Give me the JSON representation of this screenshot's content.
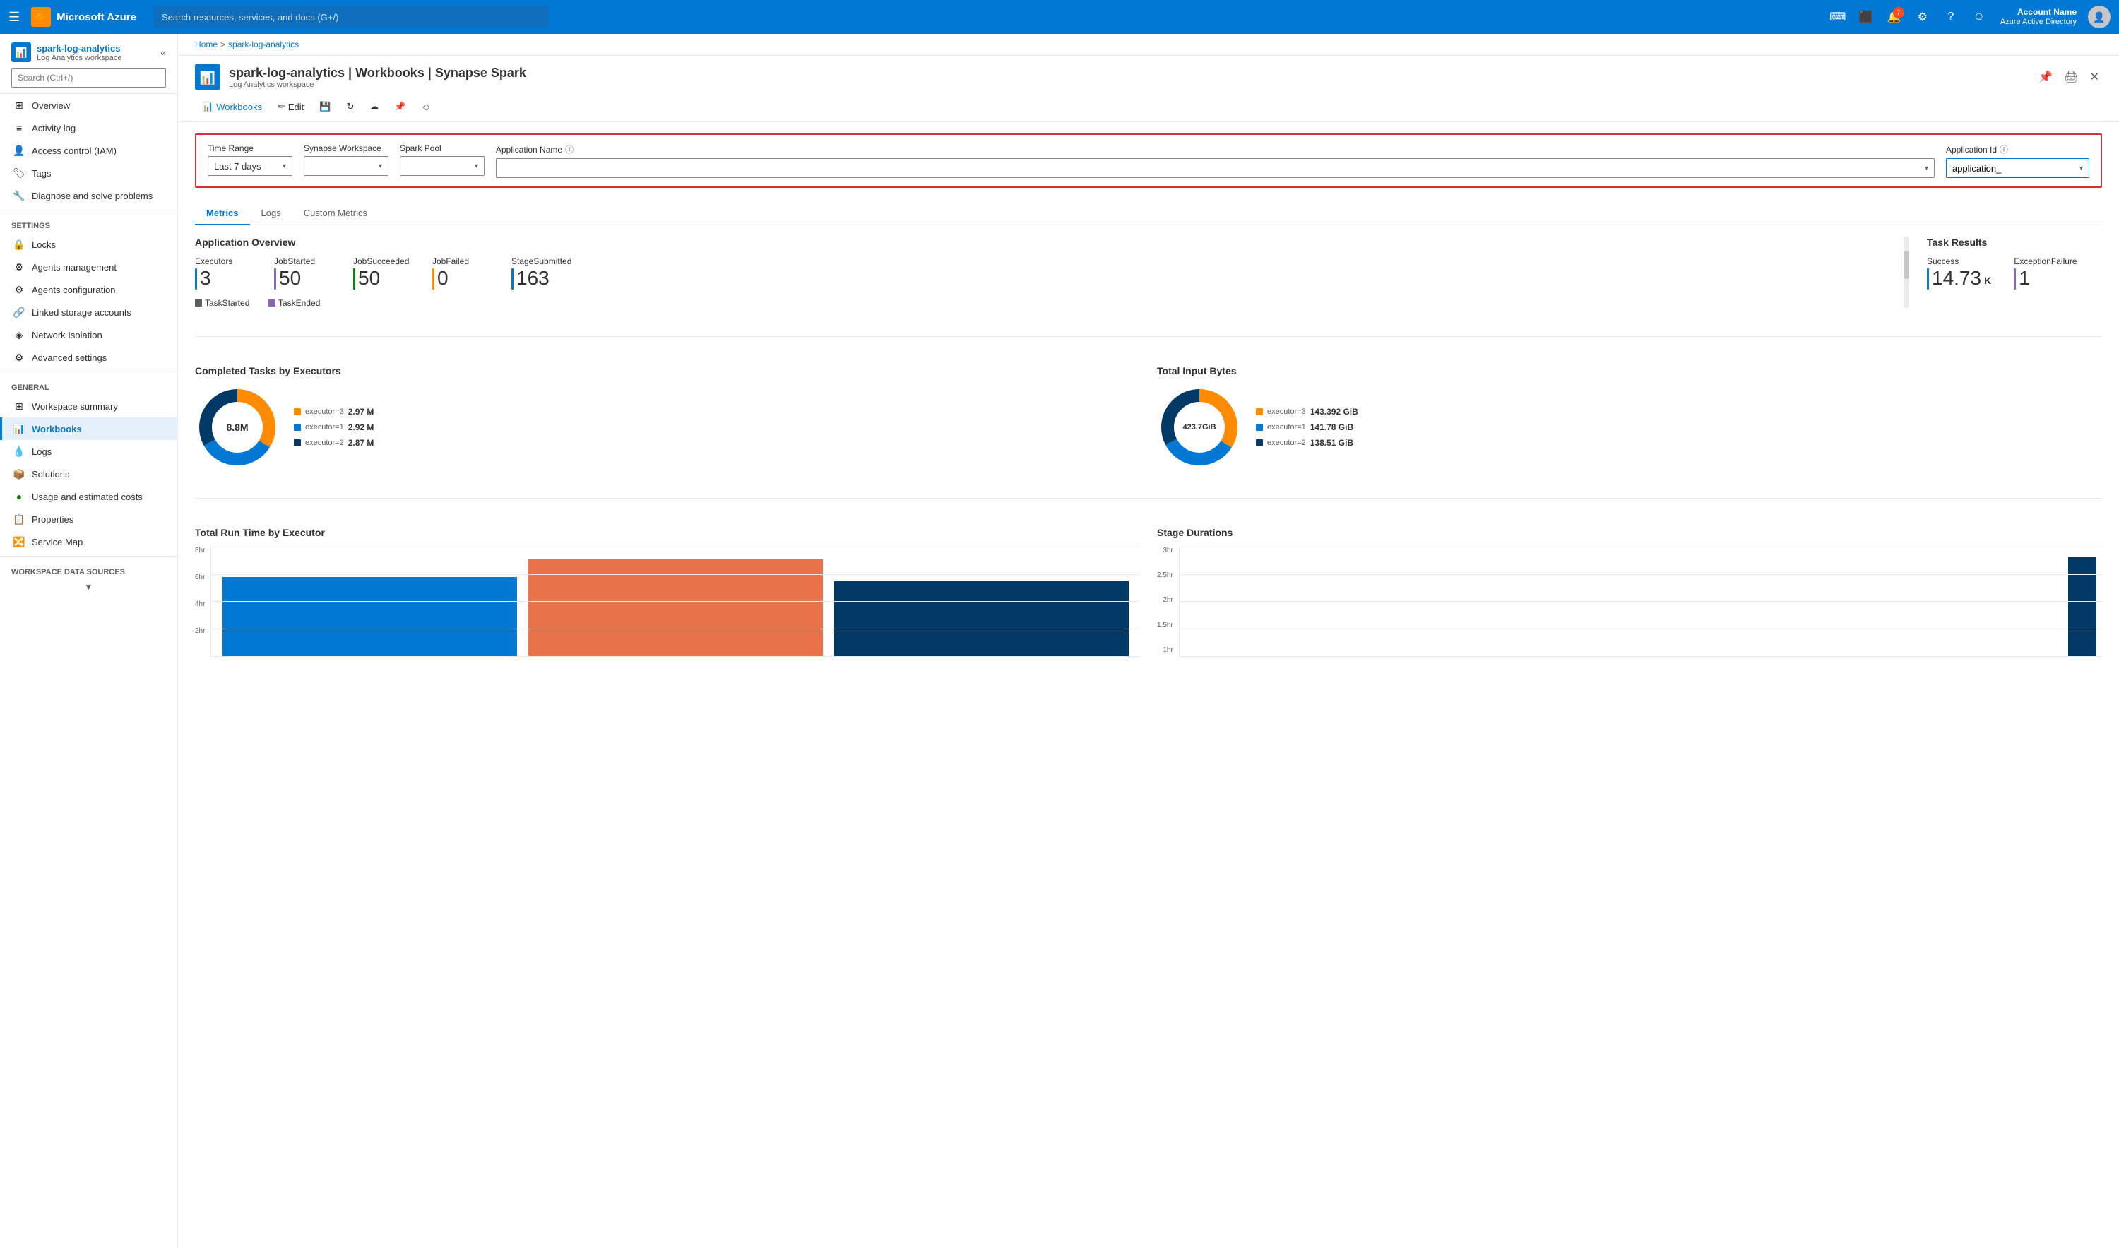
{
  "topbar": {
    "hamburger": "☰",
    "app_name": "Microsoft Azure",
    "logo_icon": "🔶",
    "search_placeholder": "Search resources, services, and docs (G+/)",
    "notification_count": "7",
    "user_name": "Account Name",
    "user_subtitle": "Azure Active Directory"
  },
  "breadcrumb": {
    "home": "Home",
    "separator": ">",
    "resource": "spark-log-analytics"
  },
  "resource_header": {
    "title": "spark-log-analytics | Workbooks | Synapse Spark",
    "subtitle": "Log Analytics workspace"
  },
  "toolbar": {
    "workbooks_label": "Workbooks",
    "edit_label": "Edit",
    "save_icon": "💾",
    "refresh_icon": "↻",
    "upload_icon": "☁",
    "pin_icon": "📌",
    "feedback_icon": "☺"
  },
  "filters": {
    "time_range_label": "Time Range",
    "time_range_value": "Last 7 days",
    "synapse_workspace_label": "Synapse Workspace",
    "synapse_workspace_value": "",
    "spark_pool_label": "Spark Pool",
    "spark_pool_value": "",
    "application_name_label": "Application Name",
    "application_name_value": "",
    "application_id_label": "Application Id",
    "application_id_value": "application_"
  },
  "tabs": [
    {
      "label": "Metrics",
      "active": true
    },
    {
      "label": "Logs",
      "active": false
    },
    {
      "label": "Custom Metrics",
      "active": false
    }
  ],
  "app_overview": {
    "section_title": "Application Overview",
    "stats": [
      {
        "label": "Executors",
        "value": "3",
        "bar_color": "#0078d4"
      },
      {
        "label": "JobStarted",
        "value": "50",
        "bar_color": "#8764b8"
      },
      {
        "label": "JobSucceeded",
        "value": "50",
        "bar_color": "#107c10"
      },
      {
        "label": "JobFailed",
        "value": "0",
        "bar_color": "#ff8c00"
      },
      {
        "label": "StageSubmitted",
        "value": "163",
        "bar_color": "#0078d4"
      }
    ]
  },
  "task_results": {
    "section_title": "Task Results",
    "stats": [
      {
        "label": "Success",
        "value": "14.73",
        "unit": "K",
        "bar_color": "#0078d4"
      },
      {
        "label": "ExceptionFailure",
        "value": "1",
        "unit": "",
        "bar_color": "#8764b8"
      }
    ]
  },
  "task_extra": [
    {
      "label": "TaskStarted",
      "bar_color": "#605e5c"
    },
    {
      "label": "TaskEnded",
      "bar_color": "#8764b8"
    }
  ],
  "completed_tasks": {
    "title": "Completed Tasks by Executors",
    "center_label": "8.8M",
    "segments": [
      {
        "label": "executor=3",
        "value": "2.97 M",
        "color": "#ff8c00",
        "pct": 33.75
      },
      {
        "label": "executor=1",
        "value": "2.92 M",
        "color": "#0078d4",
        "pct": 33.18
      },
      {
        "label": "executor=2",
        "value": "2.87 M",
        "color": "#003966",
        "pct": 33.07
      }
    ]
  },
  "total_input_bytes": {
    "title": "Total Input Bytes",
    "center_label": "423.7GiB",
    "segments": [
      {
        "label": "executor=3",
        "value": "143.392 GiB",
        "color": "#ff8c00",
        "pct": 33.84
      },
      {
        "label": "executor=1",
        "value": "141.78 GiB",
        "color": "#0078d4",
        "pct": 33.46
      },
      {
        "label": "executor=2",
        "value": "138.51 GiB",
        "color": "#003966",
        "pct": 32.7
      }
    ]
  },
  "total_runtime": {
    "title": "Total Run Time by Executor",
    "y_labels": [
      "8hr",
      "6hr",
      "4hr",
      "2hr",
      ""
    ],
    "bars": [
      {
        "color": "#0078d4",
        "height_pct": 72
      },
      {
        "color": "#e8734a",
        "height_pct": 88
      },
      {
        "color": "#003966",
        "height_pct": 68
      }
    ]
  },
  "stage_durations": {
    "title": "Stage Durations",
    "y_labels": [
      "3hr",
      "2.5hr",
      "2hr",
      "1.5hr",
      "1hr"
    ],
    "bars": [
      {
        "color": "#003966",
        "height_pct": 90
      }
    ]
  },
  "sidebar": {
    "search_placeholder": "Search (Ctrl+/)",
    "collapse_btn": "«",
    "nav_items": [
      {
        "id": "overview",
        "label": "Overview",
        "icon": "⊞",
        "section": ""
      },
      {
        "id": "activity-log",
        "label": "Activity log",
        "icon": "≡",
        "section": ""
      },
      {
        "id": "access-control",
        "label": "Access control (IAM)",
        "icon": "👤",
        "section": ""
      },
      {
        "id": "tags",
        "label": "Tags",
        "icon": "🏷",
        "section": ""
      },
      {
        "id": "diagnose",
        "label": "Diagnose and solve problems",
        "icon": "🔧",
        "section": ""
      }
    ],
    "settings_label": "Settings",
    "settings_items": [
      {
        "id": "locks",
        "label": "Locks",
        "icon": "🔒",
        "section": "Settings"
      },
      {
        "id": "agents-management",
        "label": "Agents management",
        "icon": "⚙",
        "section": "Settings"
      },
      {
        "id": "agents-configuration",
        "label": "Agents configuration",
        "icon": "⚙",
        "section": "Settings"
      },
      {
        "id": "linked-storage",
        "label": "Linked storage accounts",
        "icon": "🔗",
        "section": "Settings"
      },
      {
        "id": "network-isolation",
        "label": "Network Isolation",
        "icon": "◈",
        "section": "Settings"
      },
      {
        "id": "advanced-settings",
        "label": "Advanced settings",
        "icon": "⚙",
        "section": "Settings"
      }
    ],
    "general_label": "General",
    "general_items": [
      {
        "id": "workspace-summary",
        "label": "Workspace summary",
        "icon": "⊞",
        "section": "General"
      },
      {
        "id": "workbooks",
        "label": "Workbooks",
        "icon": "📊",
        "section": "General",
        "active": true
      },
      {
        "id": "logs",
        "label": "Logs",
        "icon": "💧",
        "section": "General"
      },
      {
        "id": "solutions",
        "label": "Solutions",
        "icon": "📦",
        "section": "General"
      },
      {
        "id": "usage-costs",
        "label": "Usage and estimated costs",
        "icon": "🟢",
        "section": "General"
      },
      {
        "id": "properties",
        "label": "Properties",
        "icon": "📋",
        "section": "General"
      },
      {
        "id": "service-map",
        "label": "Service Map",
        "icon": "🔀",
        "section": "General"
      }
    ],
    "workspace_ds_label": "Workspace Data Sources",
    "workspace_ds_items": []
  }
}
